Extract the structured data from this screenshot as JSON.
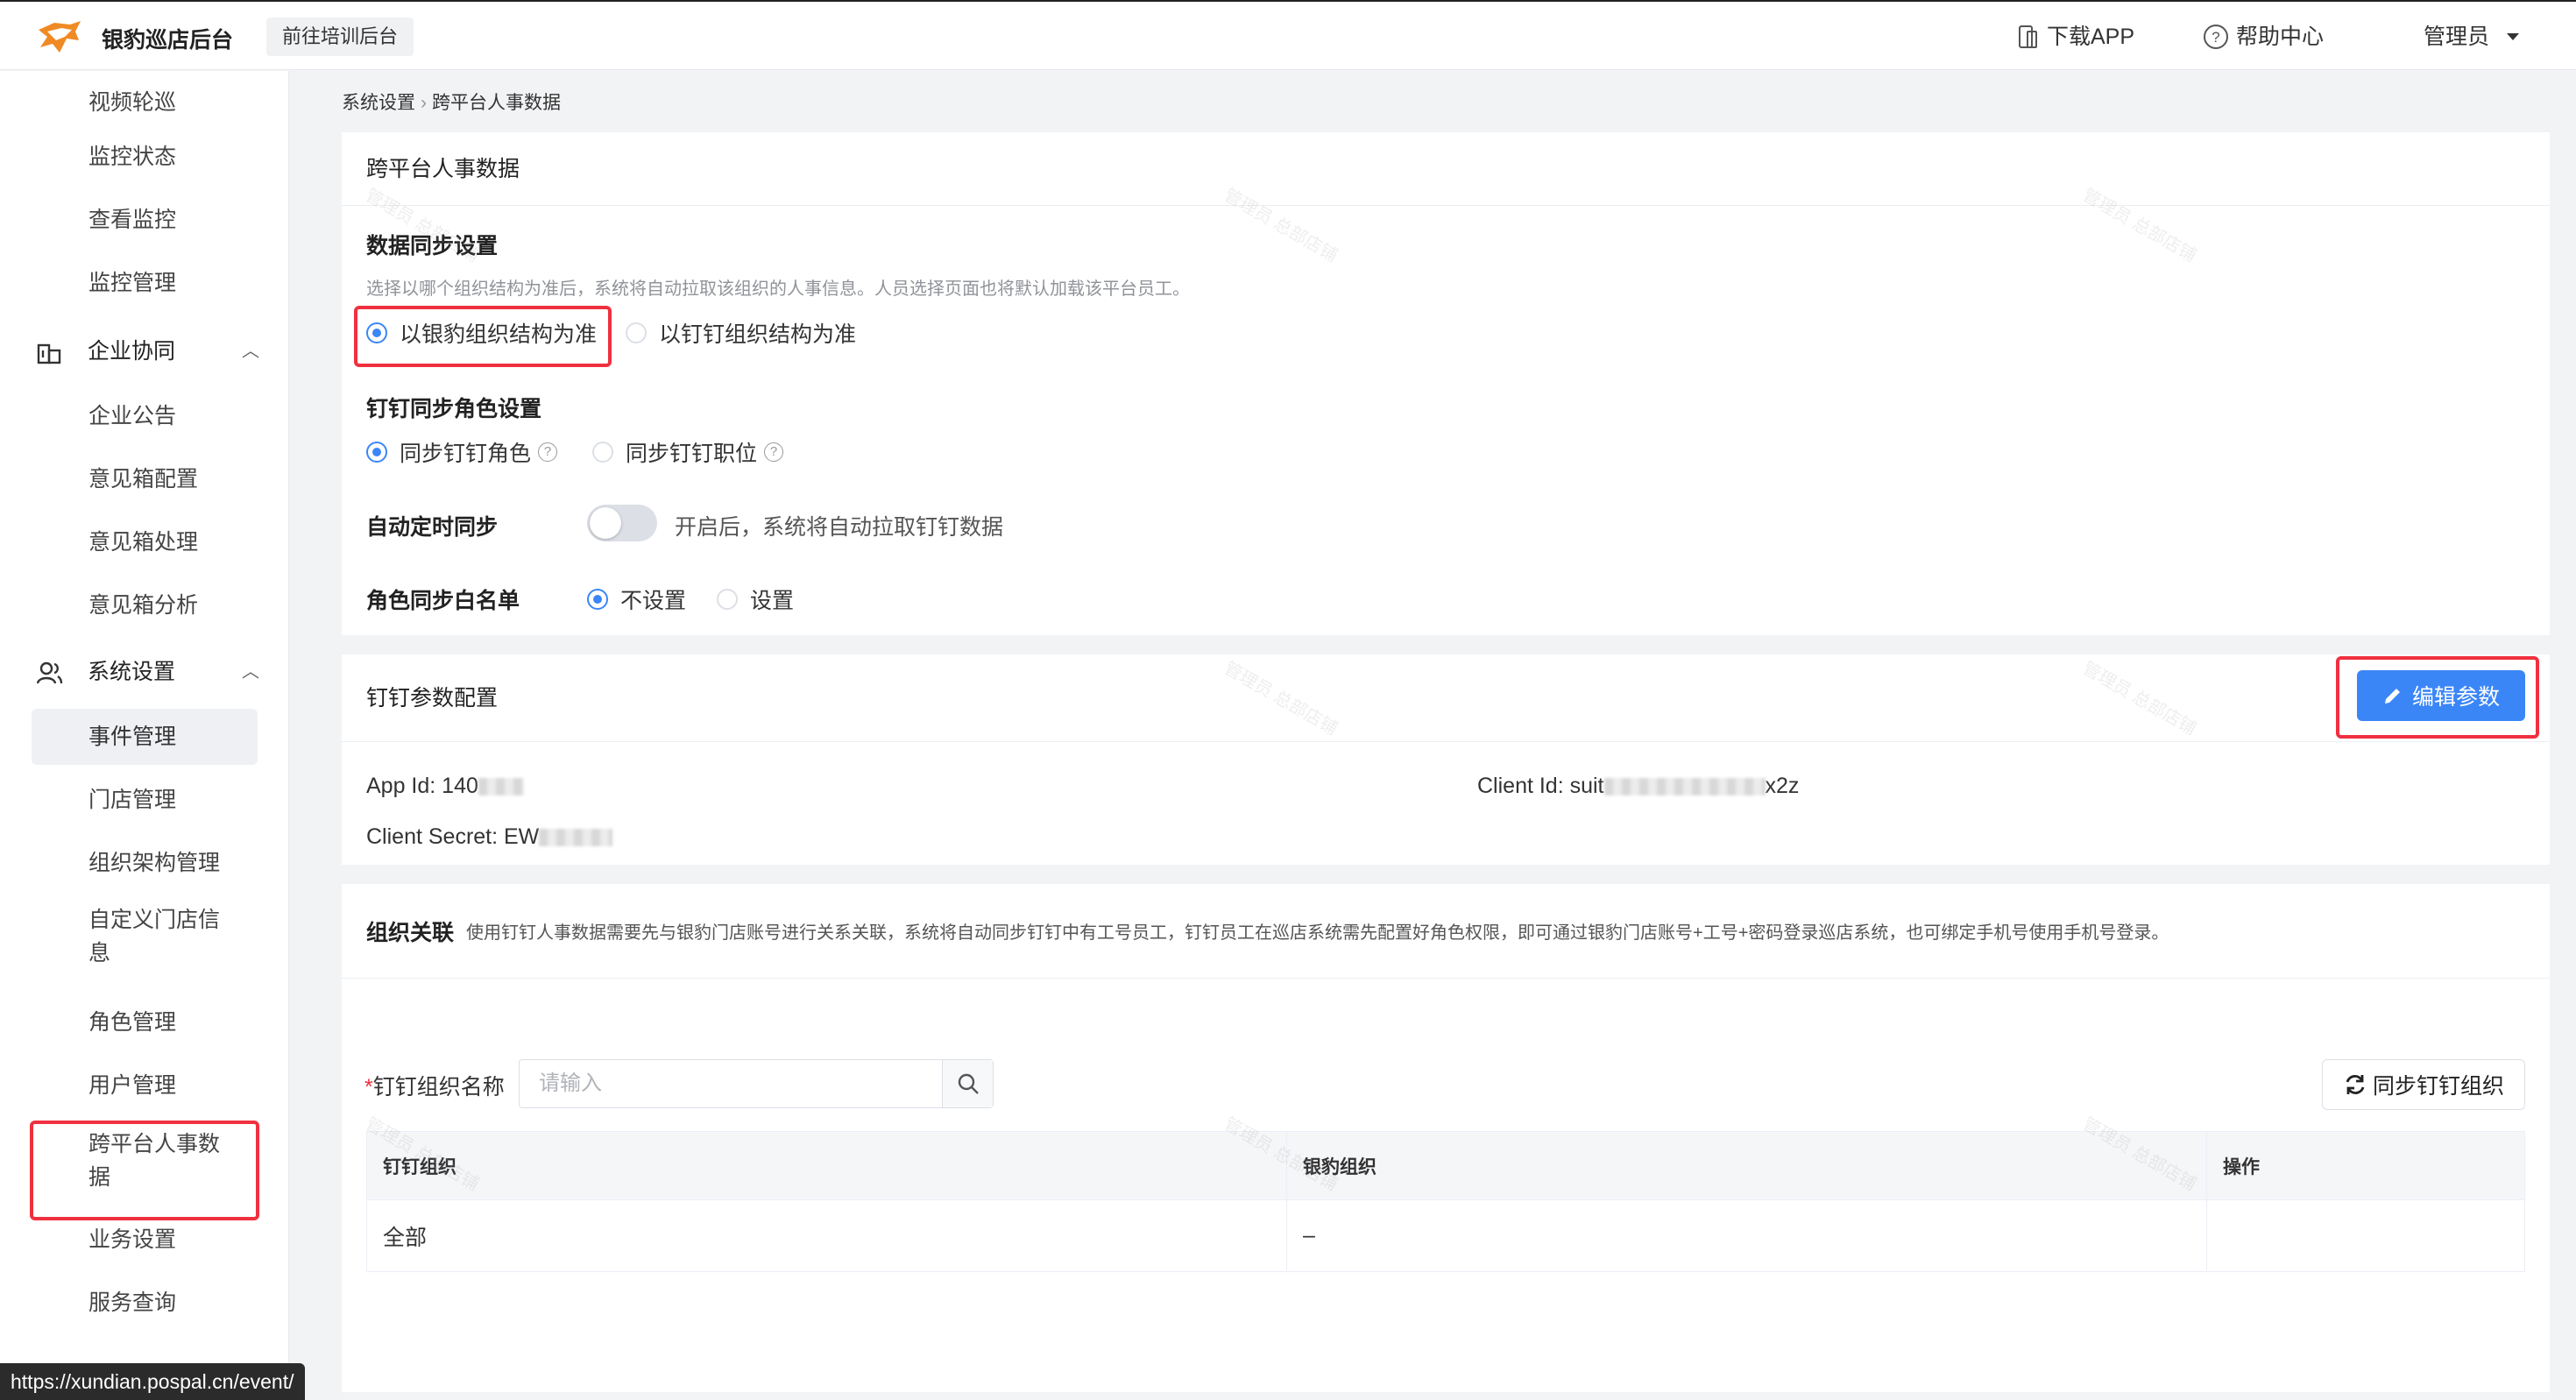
{
  "topbar": {
    "app_name": "银豹巡店后台",
    "go_training": "前往培训后台",
    "download_app": "下载APP",
    "help_center": "帮助中心",
    "user_menu": "管理员"
  },
  "sidebar": {
    "items_top": [
      "视频轮巡",
      "监控状态",
      "查看监控",
      "监控管理"
    ],
    "group_collab": "企业协同",
    "collab_items": [
      "企业公告",
      "意见箱配置",
      "意见箱处理",
      "意见箱分析"
    ],
    "group_settings": "系统设置",
    "settings_items": [
      "事件管理",
      "门店管理",
      "组织架构管理",
      "自定义门店信息",
      "角色管理",
      "用户管理",
      "跨平台人事数据",
      "业务设置",
      "服务查询"
    ]
  },
  "breadcrumb": {
    "parent": "系统设置",
    "current": "跨平台人事数据"
  },
  "panel1": {
    "title": "跨平台人事数据",
    "sync_heading": "数据同步设置",
    "sync_note": "选择以哪个组织结构为准后，系统将自动拉取该组织的人事信息。人员选择页面也将默认加载该平台员工。",
    "opt_yinbao": "以银豹组织结构为准",
    "opt_dingding": "以钉钉组织结构为准",
    "role_heading": "钉钉同步角色设置",
    "opt_sync_role": "同步钉钉角色",
    "opt_sync_position": "同步钉钉职位",
    "auto_sync_label": "自动定时同步",
    "auto_sync_note": "开启后，系统将自动拉取钉钉数据",
    "auto_sync_on": false,
    "whitelist_label": "角色同步白名单",
    "opt_not_set": "不设置",
    "opt_set": "设置"
  },
  "panel2": {
    "title": "钉钉参数配置",
    "edit_button": "编辑参数",
    "app_id_label": "App Id: 140",
    "client_id_label": "Client Id: suit",
    "client_id_suffix": "x2z",
    "client_secret_label": "Client Secret: EW"
  },
  "panel3": {
    "title": "组织关联",
    "desc": "使用钉钉人事数据需要先与银豹门店账号进行关系关联，系统将自动同步钉钉中有工号员工，钉钉员工在巡店系统需先配置好角色权限，即可通过银豹门店账号+工号+密码登录巡店系统，也可绑定手机号使用手机号登录。",
    "field_label": "钉钉组织名称",
    "required_mark": "*",
    "search_placeholder": "请输入",
    "sync_button": "同步钉钉组织",
    "table": {
      "headers": [
        "钉钉组织",
        "银豹组织",
        "操作"
      ],
      "rows": [
        [
          "全部",
          "–",
          ""
        ]
      ]
    }
  },
  "status_url": "https://xundian.pospal.cn/event/",
  "watermark": "管理员 总部店铺",
  "colors": {
    "primary": "#3b86f7",
    "highlight": "#f0303f"
  }
}
